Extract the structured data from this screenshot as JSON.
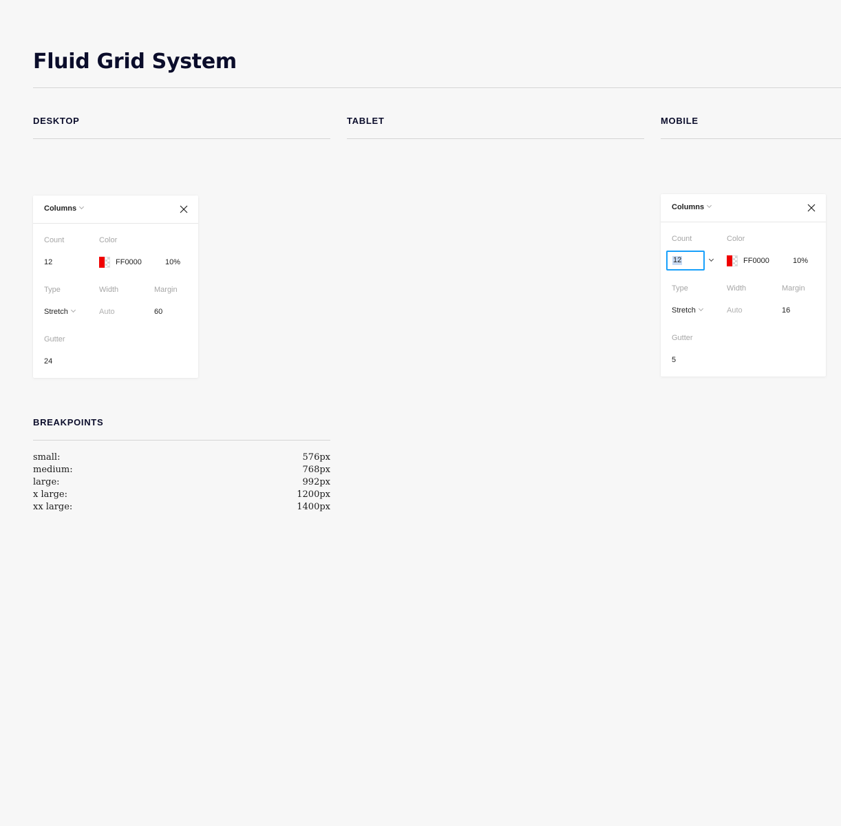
{
  "page": {
    "title": "Fluid Grid System"
  },
  "sections": {
    "desktop": "DESKTOP",
    "tablet": "TABLET",
    "mobile": "MOBILE",
    "breakpoints": "BREAKPOINTS"
  },
  "panels": {
    "desktop": {
      "title": "Columns",
      "count_label": "Count",
      "count_value": "12",
      "color_label": "Color",
      "color_hex": "FF0000",
      "color_opacity": "10%",
      "type_label": "Type",
      "type_value": "Stretch",
      "width_label": "Width",
      "width_value": "Auto",
      "margin_label": "Margin",
      "margin_value": "60",
      "gutter_label": "Gutter",
      "gutter_value": "24"
    },
    "mobile": {
      "title": "Columns",
      "count_label": "Count",
      "count_value": "12",
      "color_label": "Color",
      "color_hex": "FF0000",
      "color_opacity": "10%",
      "type_label": "Type",
      "type_value": "Stretch",
      "width_label": "Width",
      "width_value": "Auto",
      "margin_label": "Margin",
      "margin_value": "16",
      "gutter_label": "Gutter",
      "gutter_value": "5"
    }
  },
  "breakpoints": [
    {
      "name": "small:",
      "value": "576px"
    },
    {
      "name": "medium:",
      "value": "768px"
    },
    {
      "name": "large:",
      "value": "992px"
    },
    {
      "name": "x large:",
      "value": "1200px"
    },
    {
      "name": "xx large:",
      "value": "1400px"
    }
  ],
  "colors": {
    "swatch": "#f00000",
    "focus": "#18a0fb",
    "heading": "#0b0d2b"
  },
  "icons": {
    "close": "close-icon",
    "dropdown": "chevron-down-icon"
  }
}
